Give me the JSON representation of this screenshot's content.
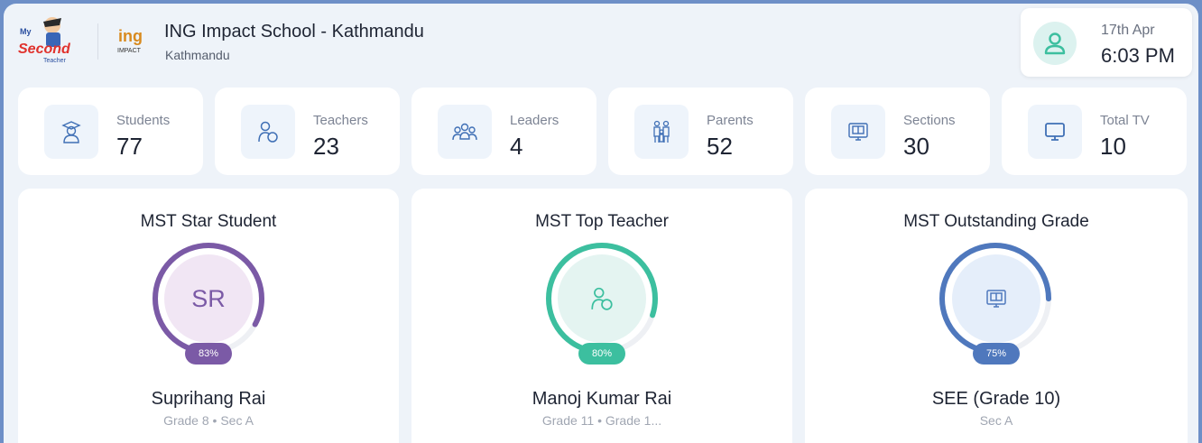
{
  "header": {
    "school_name": "ING Impact School - Kathmandu",
    "school_city": "Kathmandu",
    "logo_mst": {
      "line1": "My",
      "line2": "Second",
      "line3": "Teacher"
    },
    "logo_ing": {
      "line1": "ing",
      "line2": "IMPACT"
    },
    "clock": {
      "date": "17th Apr",
      "time": "6:03 PM"
    }
  },
  "stats": [
    {
      "label": "Students",
      "value": "77",
      "icon": "student-icon"
    },
    {
      "label": "Teachers",
      "value": "23",
      "icon": "teacher-icon"
    },
    {
      "label": "Leaders",
      "value": "4",
      "icon": "leaders-icon"
    },
    {
      "label": "Parents",
      "value": "52",
      "icon": "parents-icon"
    },
    {
      "label": "Sections",
      "value": "30",
      "icon": "sections-icon"
    },
    {
      "label": "Total TV",
      "value": "10",
      "icon": "tv-icon"
    }
  ],
  "awards": [
    {
      "title": "MST Star Student",
      "initials": "SR",
      "percent_label": "83%",
      "progress": 0.83,
      "name": "Suprihang Rai",
      "sub": "Grade 8 • Sec A",
      "color": "#7b5aa6",
      "bg": "#f1e6f4"
    },
    {
      "title": "MST Top Teacher",
      "percent_label": "80%",
      "progress": 0.8,
      "name": "Manoj Kumar Rai",
      "sub": "Grade 11 • Grade 1...",
      "color": "#3cbf9f",
      "bg": "#e4f4f1"
    },
    {
      "title": "MST Outstanding Grade",
      "percent_label": "75%",
      "progress": 0.75,
      "name": "SEE (Grade 10)",
      "sub": "Sec A",
      "color": "#4f78bd",
      "bg": "#e5eefa"
    }
  ],
  "colors": {
    "accent_teal": "#3cbf9f",
    "icon_blue": "#3f6fb5",
    "page_bg": "#eef3f9"
  }
}
